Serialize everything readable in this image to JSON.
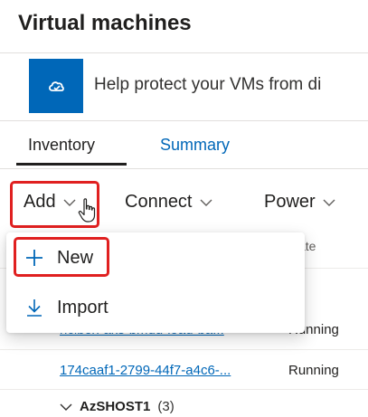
{
  "page": {
    "title": "Virtual machines"
  },
  "banner": {
    "icon": "shield-cloud-icon",
    "text": "Help protect your VMs from di"
  },
  "tabs": [
    {
      "label": "Inventory",
      "active": true
    },
    {
      "label": "Summary",
      "active": false
    }
  ],
  "toolbar": {
    "add_label": "Add",
    "connect_label": "Connect",
    "power_label": "Power"
  },
  "table": {
    "state_header": "ate",
    "rows": [
      {
        "name": "nclbox-aks-bmdu-load-ba...",
        "state": "Running"
      },
      {
        "name": "174caaf1-2799-44f7-a4c6-...",
        "state": "Running"
      }
    ],
    "group": {
      "name": "AzSHOST1",
      "count": "(3)"
    }
  },
  "add_menu": {
    "items": [
      {
        "label": "New",
        "icon": "plus-icon"
      },
      {
        "label": "Import",
        "icon": "download-icon"
      }
    ]
  },
  "colors": {
    "accent": "#0067b8",
    "highlight": "#e02020",
    "text": "#201f1e"
  }
}
